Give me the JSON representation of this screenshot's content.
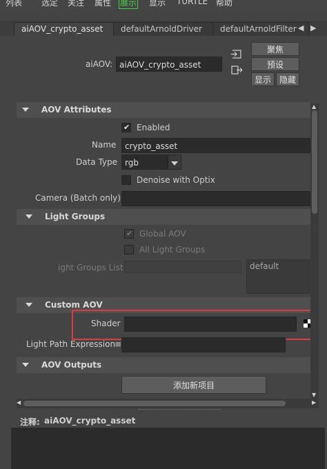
{
  "menubar": {
    "items": [
      "列表",
      "选定",
      "关注",
      "属性",
      "展示",
      "显示",
      "TURTLE",
      "帮助"
    ],
    "active_index": 4
  },
  "tabs": [
    "aiAOV_crypto_asset",
    "defaultArnoldDriver",
    "defaultArnoldFilter"
  ],
  "header": {
    "aov_label": "aiAOV:",
    "aov_value": "aiAOV_crypto_asset",
    "focus_label": "聚焦",
    "presets_label": "预设",
    "show_label": "显示",
    "hide_label": "隐藏"
  },
  "aov_attributes": {
    "title": "AOV Attributes",
    "enabled_label": "Enabled",
    "name_label": "Name",
    "name_value": "crypto_asset",
    "data_type_label": "Data Type",
    "data_type_value": "rgb",
    "denoise_label": "Denoise with Optix",
    "camera_label": "Camera (Batch only)"
  },
  "light_groups": {
    "title": "Light Groups",
    "global_aov_label": "Global AOV",
    "all_light_groups_label": "All Light Groups",
    "list_label": "ight Groups List",
    "list_default": "default"
  },
  "custom_aov": {
    "title": "Custom AOV",
    "shader_label": "Shader",
    "light_path_label": "Light Path Expression"
  },
  "aov_outputs": {
    "title": "AOV Outputs",
    "add_button_label": "添加新项目"
  },
  "notes": {
    "label": "注释:",
    "value": "aiAOV_crypto_asset"
  },
  "colors": {
    "highlight_box": "#e0393f",
    "active_menu": "#46d246"
  }
}
